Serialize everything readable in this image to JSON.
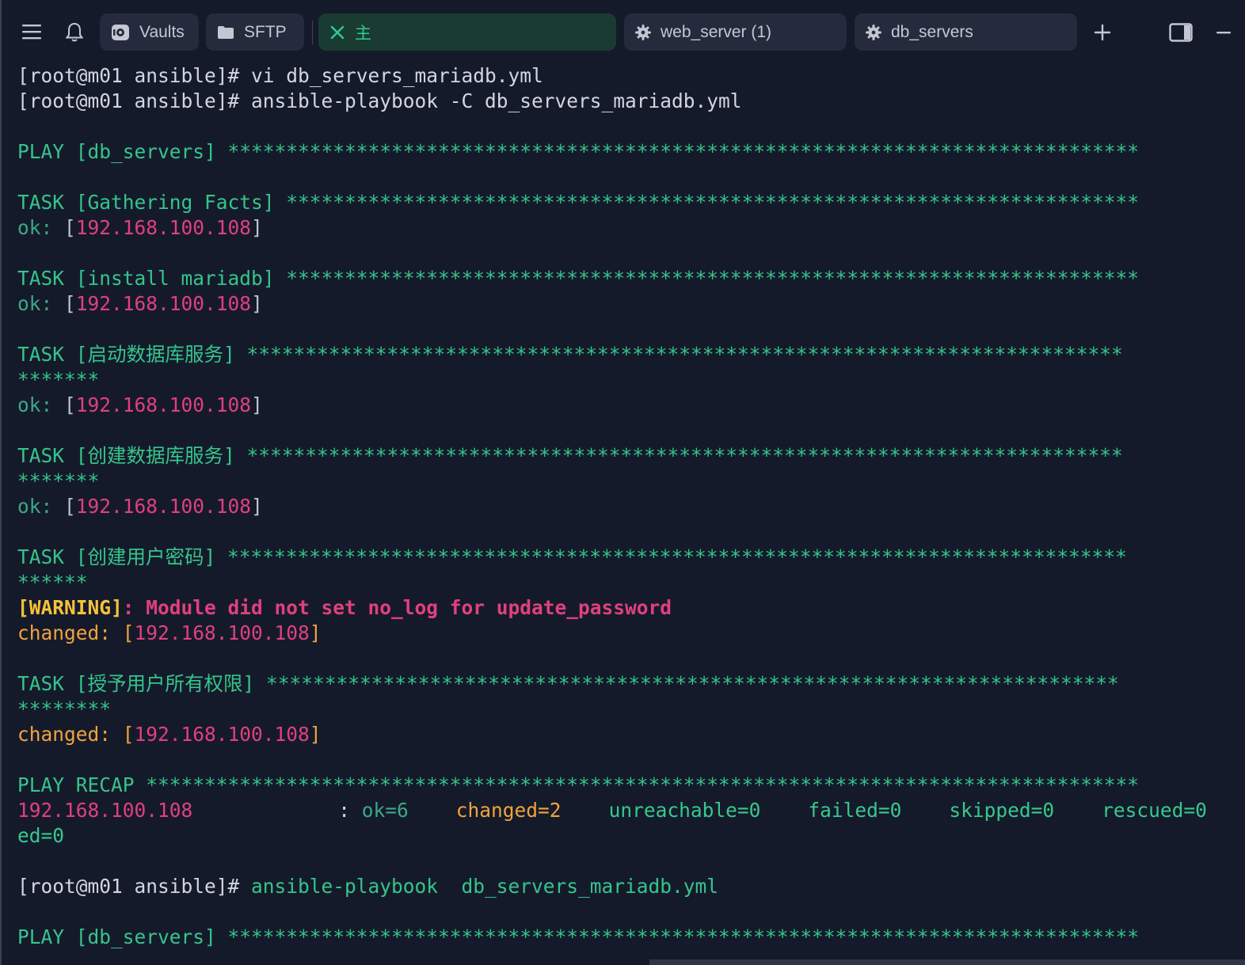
{
  "tabs": [
    {
      "label": "Vaults",
      "icon": "vault-icon"
    },
    {
      "label": "SFTP",
      "icon": "folder-icon"
    },
    {
      "label": "主",
      "icon": "close-icon",
      "active": true
    },
    {
      "label": "web_server (1)",
      "icon": "gear-icon"
    },
    {
      "label": "db_servers",
      "icon": "gear-icon"
    }
  ],
  "terminal": {
    "prompt": "[root@m01 ansible]#",
    "cmd1": " vi db_servers_mariadb.yml",
    "cmd2": " ansible-playbook -C db_servers_mariadb.yml",
    "play1": "PLAY [db_servers] ******************************************************************************",
    "task1": "TASK [Gathering Facts] *************************************************************************",
    "task2": "TASK [install mariadb] *************************************************************************",
    "task3": "TASK [启动数据库服务] ***************************************************************************",
    "task3_wrap": "*******",
    "task4": "TASK [创建数据库服务] ***************************************************************************",
    "task4_wrap": "*******",
    "task5": "TASK [创建用户密码] *****************************************************************************",
    "task5_wrap": "******",
    "task6": "TASK [授予用户所有权限] *************************************************************************",
    "task6_wrap": "********",
    "ok_label": "ok: ",
    "changed_label": "changed: ",
    "lb": "[",
    "rb": "]",
    "host": "192.168.100.108",
    "warning_key": "[WARNING]",
    "warning_msg": ": Module did not set no_log for update_password",
    "recap": "PLAY RECAP *************************************************************************************",
    "recap_host": "192.168.100.108",
    "recap_colon": ": ",
    "recap_ok": "ok=6",
    "recap_changed": "changed=2",
    "recap_unreachable": "unreachable=0",
    "recap_failed": "failed=0",
    "recap_skipped": "skipped=0",
    "recap_rescued": "rescued=0",
    "recap_wrap": "ed=0",
    "cmd3": " ansible-playbook  db_servers_mariadb.yml",
    "play2": "PLAY [db_servers] ******************************************************************************"
  }
}
